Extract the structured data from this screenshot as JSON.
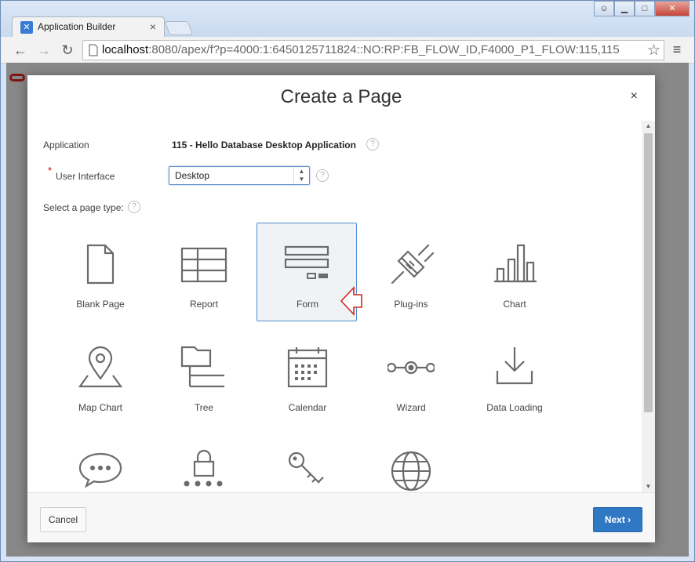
{
  "browser": {
    "tab_title": "Application Builder",
    "tab_close": "×",
    "url_host": "localhost",
    "url_rest": ":8080/apex/f?p=4000:1:6450125711824::NO:RP:FB_FLOW_ID,F4000_P1_FLOW:115,115",
    "back": "←",
    "forward": "→",
    "reload": "↻",
    "star": "☆",
    "menu": "≡",
    "win_min": "▁",
    "win_max": "□",
    "win_close": "✕"
  },
  "dialog": {
    "title": "Create a Page",
    "close": "×",
    "application_label": "Application",
    "application_value": "115 - Hello Database Desktop Application",
    "ui_required_mark": "*",
    "ui_label": "User Interface",
    "ui_value": "Desktop",
    "page_type_label": "Select a page type:",
    "help": "?",
    "tiles": [
      {
        "label": "Blank Page",
        "icon": "blank-page-icon"
      },
      {
        "label": "Report",
        "icon": "report-icon"
      },
      {
        "label": "Form",
        "icon": "form-icon",
        "selected": true
      },
      {
        "label": "Plug-ins",
        "icon": "plug-icon"
      },
      {
        "label": "Chart",
        "icon": "chart-icon"
      },
      {
        "label": "Map Chart",
        "icon": "map-pin-icon"
      },
      {
        "label": "Tree",
        "icon": "tree-icon"
      },
      {
        "label": "Calendar",
        "icon": "calendar-icon"
      },
      {
        "label": "Wizard",
        "icon": "wizard-icon"
      },
      {
        "label": "Data Loading",
        "icon": "download-icon"
      },
      {
        "label": "",
        "icon": "chat-icon"
      },
      {
        "label": "",
        "icon": "lock-icon"
      },
      {
        "label": "",
        "icon": "key-icon"
      },
      {
        "label": "",
        "icon": "globe-icon"
      }
    ],
    "cancel_label": "Cancel",
    "next_label": "Next",
    "next_chevron": "›"
  },
  "colors": {
    "accent": "#2f78c4",
    "selected_border": "#4f8fcf",
    "icon_stroke": "#6b6b6b",
    "annotation_arrow": "#d0281f"
  }
}
